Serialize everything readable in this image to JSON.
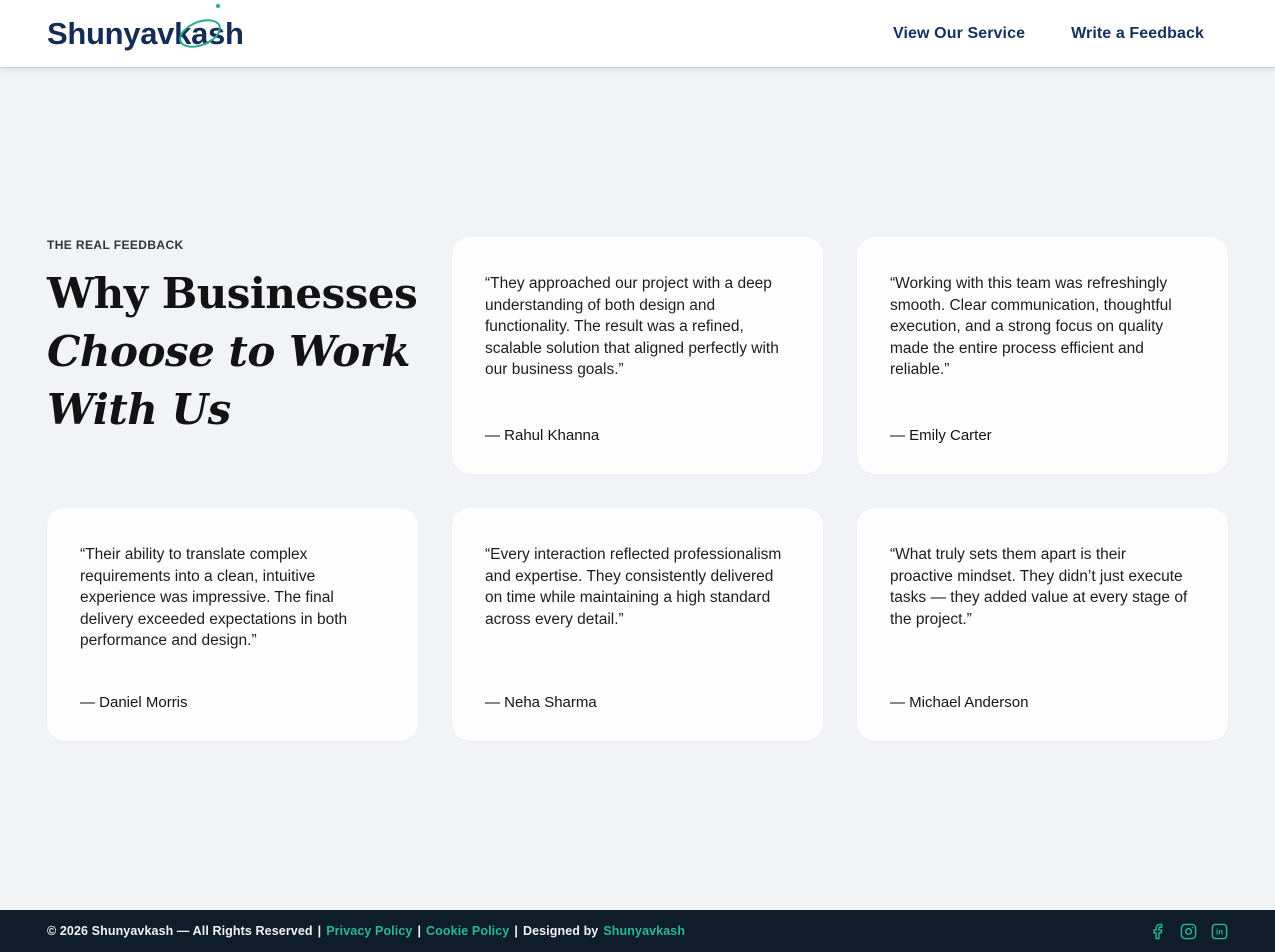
{
  "colors": {
    "accent_teal": "#2ab795",
    "brand_navy": "#14305c",
    "footer_bg": "#0e1d29",
    "page_bg": "#f1f3f6",
    "card_bg": "#fdfdfe"
  },
  "brand": {
    "prefix": "Shunyavk",
    "orbit_letter": "a",
    "suffix": "sh"
  },
  "nav": {
    "items": [
      {
        "label": "View Our Service"
      },
      {
        "label": "Write a Feedback"
      }
    ]
  },
  "hero": {
    "eyebrow": "THE REAL FEEDBACK",
    "title_lines": [
      "Why Businesses",
      "Choose to Work",
      "With Us"
    ]
  },
  "testimonials": [
    {
      "quote": "“They approached our project with a deep understanding of both design and functionality. The result was a refined, scalable solution that aligned perfectly with our business goals.”",
      "author": "— Rahul Khanna"
    },
    {
      "quote": "“Working with this team was refreshingly smooth. Clear communication, thoughtful execution, and a strong focus on quality made the entire process efficient and reliable.”",
      "author": "— Emily Carter"
    },
    {
      "quote": "“Their ability to translate complex requirements into a clean, intuitive experience was impressive. The final delivery exceeded expectations in both performance and design.”",
      "author": "— Daniel Morris"
    },
    {
      "quote": "“Every interaction reflected professionalism and expertise. They consistently delivered on time while maintaining a high standard across every detail.”",
      "author": "— Neha Sharma"
    },
    {
      "quote": "“What truly sets them apart is their proactive mindset. They didn’t just execute tasks — they added value at every stage of the project.”",
      "author": "— Michael Anderson"
    }
  ],
  "footer": {
    "copyright": "© 2026 Shunyavkash — All Rights Reserved",
    "separator": "|",
    "privacy_link": "Privacy Policy",
    "cookie_link": "Cookie Policy",
    "designed_by_label": "Designed by",
    "designed_by_link": "Shunyavkash",
    "socials": [
      {
        "name": "facebook"
      },
      {
        "name": "instagram"
      },
      {
        "name": "linkedin"
      }
    ]
  }
}
